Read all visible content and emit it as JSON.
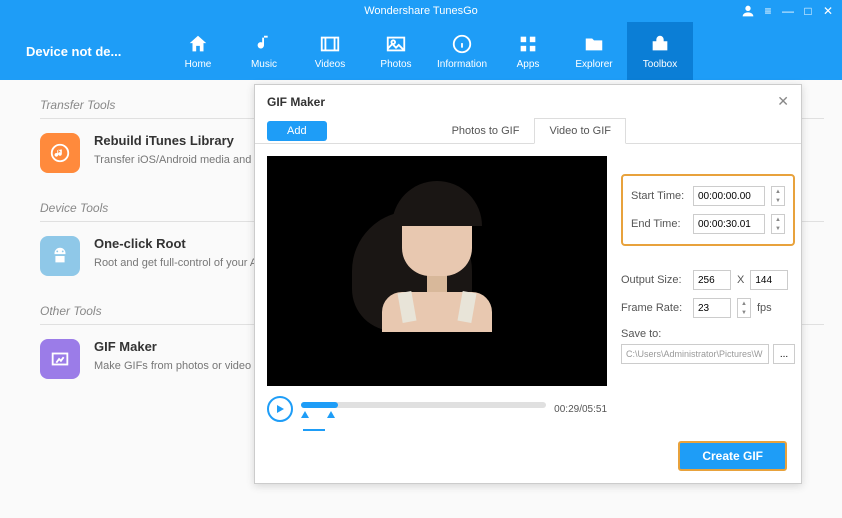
{
  "app": {
    "title": "Wondershare TunesGo",
    "device": "Device not de..."
  },
  "nav": {
    "items": [
      {
        "label": "Home"
      },
      {
        "label": "Music"
      },
      {
        "label": "Videos"
      },
      {
        "label": "Photos"
      },
      {
        "label": "Information"
      },
      {
        "label": "Apps"
      },
      {
        "label": "Explorer"
      },
      {
        "label": "Toolbox"
      }
    ],
    "active_index": 7
  },
  "sidebar": {
    "section1": "Transfer Tools",
    "tool1": {
      "title": "Rebuild iTunes Library",
      "desc": "Transfer iOS/Android media and Playlists to iTunes"
    },
    "section2": "Device Tools",
    "tool2": {
      "title": "One-click Root",
      "desc": "Root and get full-control of your Android devices."
    },
    "section3": "Other Tools",
    "tool3": {
      "title": "GIF Maker",
      "desc": "Make GIFs from photos or video"
    }
  },
  "dialog": {
    "title": "GIF Maker",
    "add_label": "Add",
    "tabs": [
      {
        "label": "Photos to GIF"
      },
      {
        "label": "Video to GIF"
      }
    ],
    "active_tab": 1,
    "playback": {
      "time": "00:29/05:51"
    },
    "settings": {
      "start_label": "Start Time:",
      "start_value": "00:00:00.00",
      "end_label": "End Time:",
      "end_value": "00:00:30.01",
      "output_label": "Output Size:",
      "width": "256",
      "height": "144",
      "fps_label": "Frame Rate:",
      "fps": "23",
      "fps_unit": "fps",
      "save_label": "Save to:",
      "save_path": "C:\\Users\\Administrator\\Pictures\\W",
      "browse": "..."
    },
    "create_label": "Create GIF"
  },
  "icons": {
    "x_mult": "X"
  }
}
